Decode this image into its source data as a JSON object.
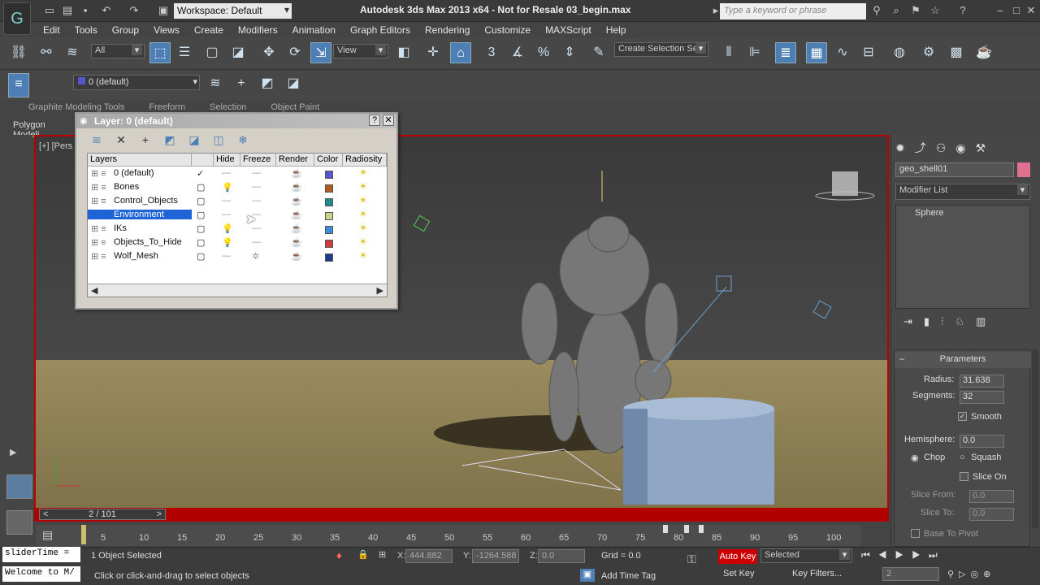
{
  "app": {
    "title": "Autodesk 3ds Max  2013 x64  -  Not for Resale    03_begin.max",
    "workspace": "Workspace: Default",
    "search_placeholder": "Type a keyword or phrase"
  },
  "menu": [
    "Edit",
    "Tools",
    "Group",
    "Views",
    "Create",
    "Modifiers",
    "Animation",
    "Graph Editors",
    "Rendering",
    "Customize",
    "MAXScript",
    "Help"
  ],
  "toolbar": {
    "filter_value": "All",
    "refcoord_value": "View",
    "selection_set_placeholder": "Create Selection Se",
    "snap_3": "3",
    "angle_snap": "%",
    "layer_current": "0 (default)"
  },
  "ribbon": {
    "tabs": [
      "Graphite Modeling Tools",
      "Freeform",
      "Selection",
      "Object Paint"
    ],
    "sub": "Polygon Modeli"
  },
  "viewport": {
    "label": "[+] [Pers"
  },
  "layer_dialog": {
    "title": "Layer: 0 (default)",
    "columns": [
      "Layers",
      "",
      "Hide",
      "Freeze",
      "Render",
      "Color",
      "Radiosity"
    ],
    "rows": [
      {
        "name": "0 (default)",
        "color": "#5555cc",
        "current": true
      },
      {
        "name": "Bones",
        "color": "#b05a1e"
      },
      {
        "name": "Control_Objects",
        "color": "#1e8a8a"
      },
      {
        "name": "Environment",
        "color": "#c8d48c",
        "selected": true
      },
      {
        "name": "IKs",
        "color": "#3c8cdc"
      },
      {
        "name": "Objects_To_Hide",
        "color": "#d03c3c"
      },
      {
        "name": "Wolf_Mesh",
        "color": "#1e3c8c"
      }
    ]
  },
  "command_panel": {
    "object_name": "geo_shell01",
    "modifier_list": "Modifier List",
    "stack_item": "Sphere",
    "rollout_title": "Parameters",
    "params": {
      "radius_label": "Radius:",
      "radius": "31.638",
      "segments_label": "Segments:",
      "segments": "32",
      "smooth_label": "Smooth",
      "hemisphere_label": "Hemisphere:",
      "hemisphere": "0.0",
      "chop_label": "Chop",
      "squash_label": "Squash",
      "slice_on_label": "Slice On",
      "slice_from_label": "Slice From:",
      "slice_from": "0.0",
      "slice_to_label": "Slice To:",
      "slice_to": "0.0",
      "base_to_pivot_label": "Base To Pivot"
    }
  },
  "timeline": {
    "frame_display": "2 / 101",
    "ticks": [
      "5",
      "10",
      "15",
      "20",
      "25",
      "30",
      "35",
      "40",
      "45",
      "50",
      "55",
      "60",
      "65",
      "70",
      "75",
      "80",
      "85",
      "90",
      "95",
      "100"
    ]
  },
  "status": {
    "maxscript_1": "sliderTime =",
    "maxscript_2": "Welcome to M/",
    "selected_text": "1 Object Selected",
    "prompt": "Click or click-and-drag to select objects",
    "x_label": "X:",
    "x": "444.882",
    "y_label": "Y:",
    "y": "-1264.588",
    "z_label": "Z:",
    "z": "0.0",
    "grid": "Grid = 0.0",
    "auto_key": "Auto Key",
    "set_key": "Set Key",
    "selected_dd": "Selected",
    "key_filters": "Key Filters...",
    "add_time_tag": "Add Time Tag",
    "current_frame": "2"
  }
}
